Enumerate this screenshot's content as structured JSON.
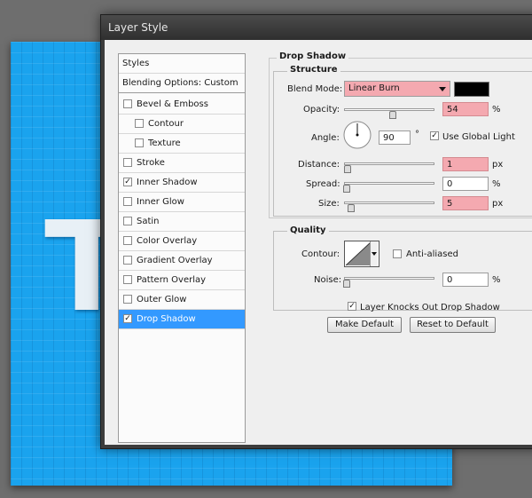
{
  "window": {
    "title": "Layer Style"
  },
  "canvas": {
    "letter": "T"
  },
  "sidebar": {
    "items": [
      {
        "label": "Styles",
        "has_checkbox": false,
        "checked": false,
        "indent": false,
        "selected": false
      },
      {
        "label": "Blending Options: Custom",
        "has_checkbox": false,
        "checked": false,
        "indent": false,
        "selected": false
      },
      {
        "label": "Bevel & Emboss",
        "has_checkbox": true,
        "checked": false,
        "indent": false,
        "selected": false
      },
      {
        "label": "Contour",
        "has_checkbox": true,
        "checked": false,
        "indent": true,
        "selected": false
      },
      {
        "label": "Texture",
        "has_checkbox": true,
        "checked": false,
        "indent": true,
        "selected": false
      },
      {
        "label": "Stroke",
        "has_checkbox": true,
        "checked": false,
        "indent": false,
        "selected": false
      },
      {
        "label": "Inner Shadow",
        "has_checkbox": true,
        "checked": true,
        "indent": false,
        "selected": false
      },
      {
        "label": "Inner Glow",
        "has_checkbox": true,
        "checked": false,
        "indent": false,
        "selected": false
      },
      {
        "label": "Satin",
        "has_checkbox": true,
        "checked": false,
        "indent": false,
        "selected": false
      },
      {
        "label": "Color Overlay",
        "has_checkbox": true,
        "checked": false,
        "indent": false,
        "selected": false
      },
      {
        "label": "Gradient Overlay",
        "has_checkbox": true,
        "checked": false,
        "indent": false,
        "selected": false
      },
      {
        "label": "Pattern Overlay",
        "has_checkbox": true,
        "checked": false,
        "indent": false,
        "selected": false
      },
      {
        "label": "Outer Glow",
        "has_checkbox": true,
        "checked": false,
        "indent": false,
        "selected": false
      },
      {
        "label": "Drop Shadow",
        "has_checkbox": true,
        "checked": true,
        "indent": false,
        "selected": true
      }
    ],
    "check_mark": "✓"
  },
  "drop_shadow": {
    "section_title": "Drop Shadow",
    "structure": {
      "title": "Structure",
      "blend_mode_label": "Blend Mode:",
      "blend_mode_value": "Linear Burn",
      "shadow_color": "#000000",
      "opacity_label": "Opacity:",
      "opacity_value": "54",
      "opacity_unit": "%",
      "opacity_level": 0.54,
      "angle_label": "Angle:",
      "angle_value": "90",
      "angle_unit": "°",
      "use_global_light_label": "Use Global Light",
      "use_global_light_checked": true,
      "distance_label": "Distance:",
      "distance_value": "1",
      "distance_unit": "px",
      "spread_label": "Spread:",
      "spread_value": "0",
      "spread_unit": "%",
      "size_label": "Size:",
      "size_value": "5",
      "size_unit": "px"
    },
    "quality": {
      "title": "Quality",
      "contour_label": "Contour:",
      "anti_aliased_label": "Anti-aliased",
      "anti_aliased_checked": false,
      "noise_label": "Noise:",
      "noise_value": "0",
      "noise_unit": "%"
    },
    "layer_knocks_out_label": "Layer Knocks Out Drop Shadow",
    "layer_knocks_out_checked": true,
    "make_default_label": "Make Default",
    "reset_default_label": "Reset to Default"
  },
  "colors": {
    "highlight_field": "#f4a9b0",
    "selection": "#3399ff",
    "canvas_blue": "#1aa3ee"
  }
}
